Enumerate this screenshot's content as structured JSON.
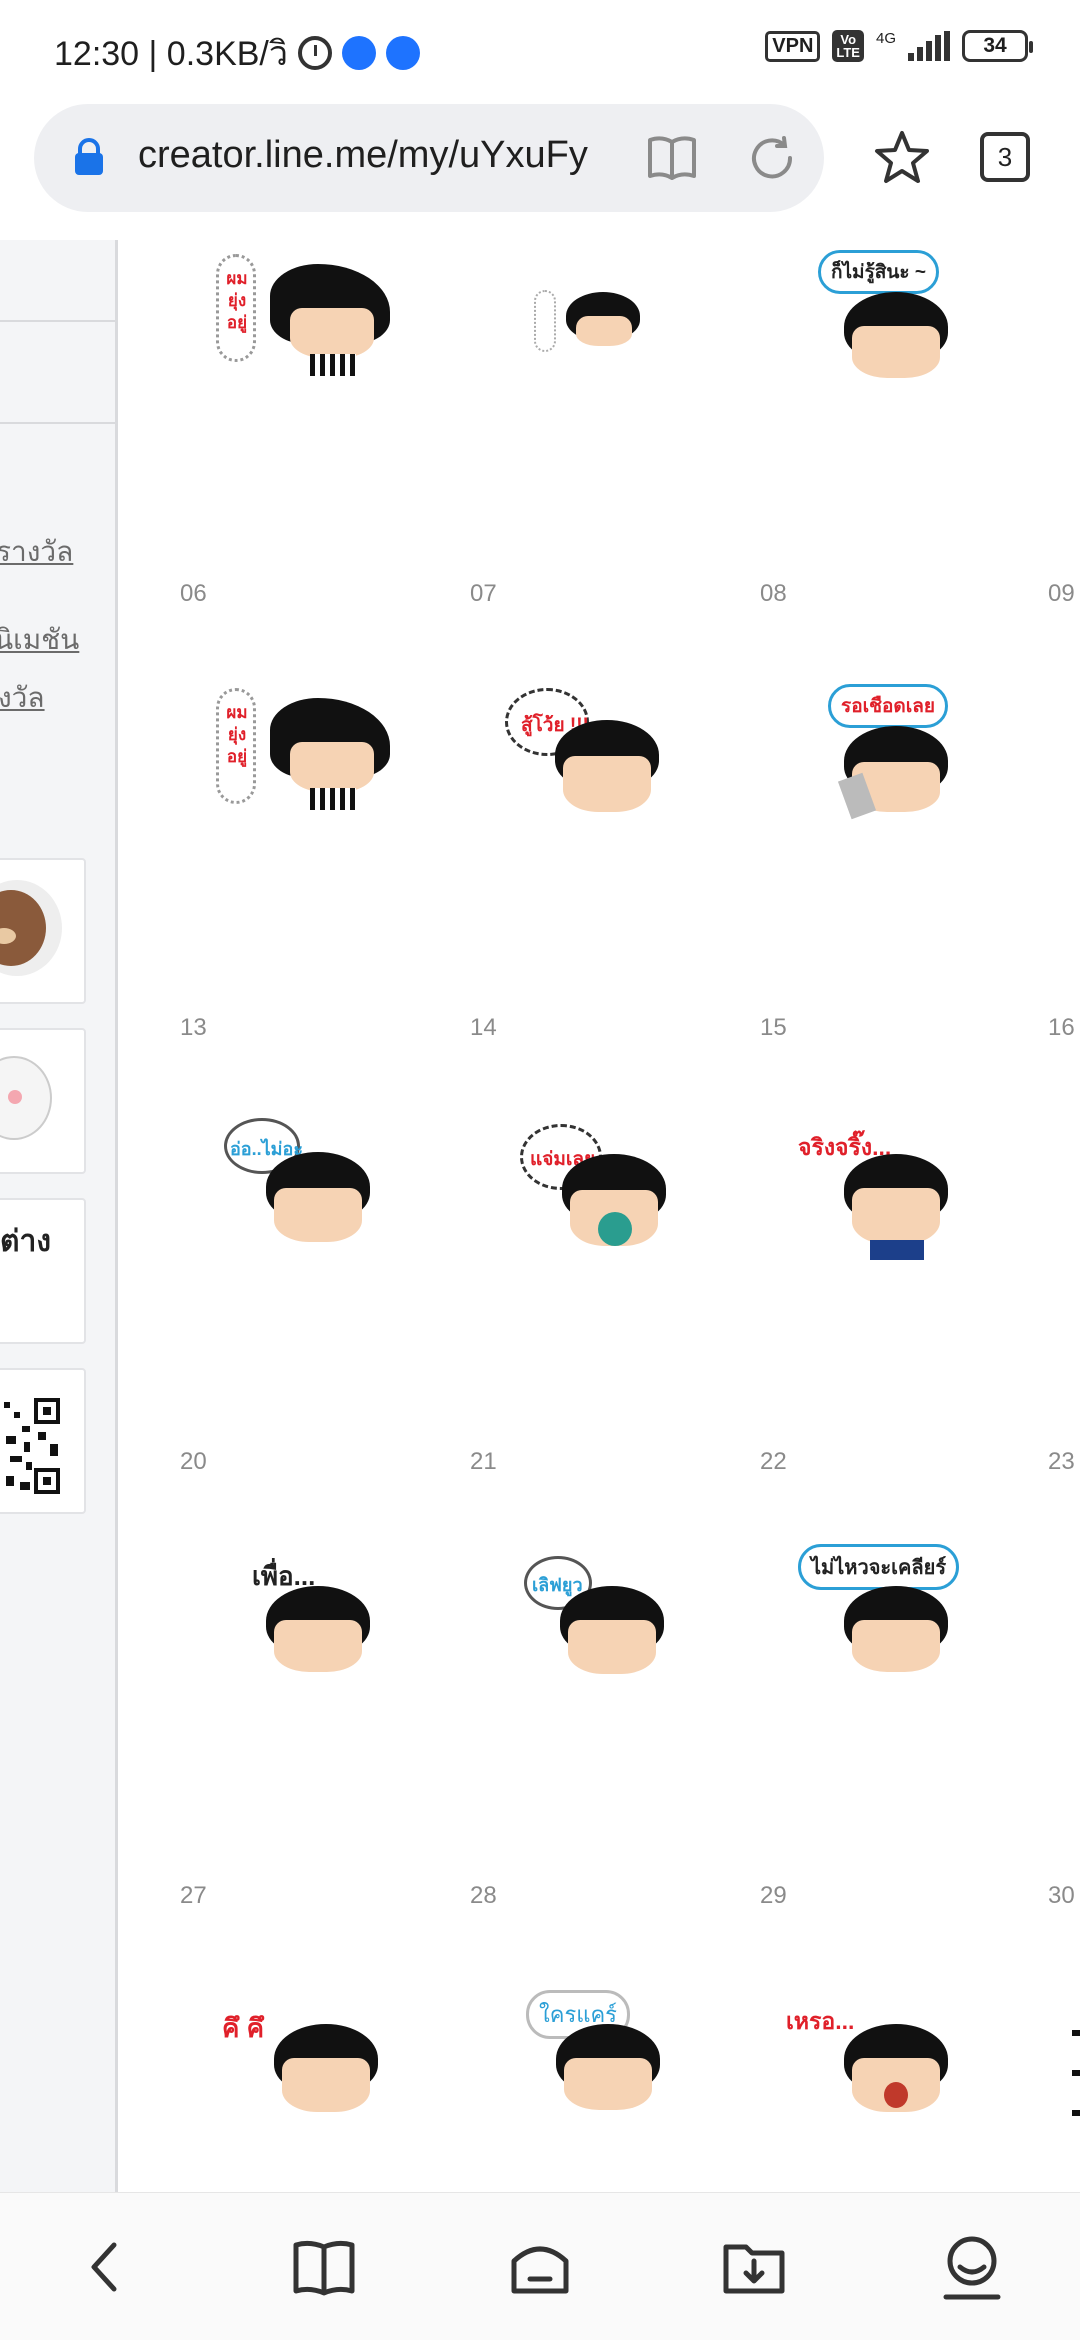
{
  "status_bar": {
    "time_and_speed": "12:30 | 0.3KB/วิ",
    "vpn": "VPN",
    "volte_top": "Vo",
    "volte_bottom": "LTE",
    "network": "4G",
    "battery": "34"
  },
  "browser": {
    "url": "creator.line.me/my/uYxuFy",
    "tab_count": "3"
  },
  "left_panel": {
    "link1": "รางวัล",
    "link2": "นิเมชัน",
    "link3": "งวัล",
    "bold_text": "ต่าง"
  },
  "sticker_grid": {
    "numbers": [
      "06",
      "07",
      "08",
      "09",
      "13",
      "14",
      "15",
      "16",
      "20",
      "21",
      "22",
      "23",
      "27",
      "28",
      "29",
      "30"
    ],
    "captions": {
      "row0_col0": "ผม ยุ่ง อยู่",
      "row0_col2": "ก็ไม่รู้สินะ ~",
      "row1_col0": "ผม ยุ่ง อยู่",
      "row1_col1": "สู้โว้ย !!!",
      "row1_col2": "รอเชือดเลย",
      "row2_col0": "อ่อ..ไม่อะ",
      "row2_col1": "แจ่มเลย",
      "row2_col2": "จริงจริ๊ง...",
      "row3_col0": "เพื่อ...",
      "row3_col1": "เลิฟยูว",
      "row3_col2": "ไม่ไหวจะเคลียร์",
      "row4_col0": "คึ คึ",
      "row4_col1": "ใครแคร์",
      "row4_col2": "เหรอ..."
    }
  },
  "colors": {
    "accent_blue": "#1e73ff",
    "caption_red": "#e0202a",
    "caption_blue": "#2b9fd6"
  }
}
